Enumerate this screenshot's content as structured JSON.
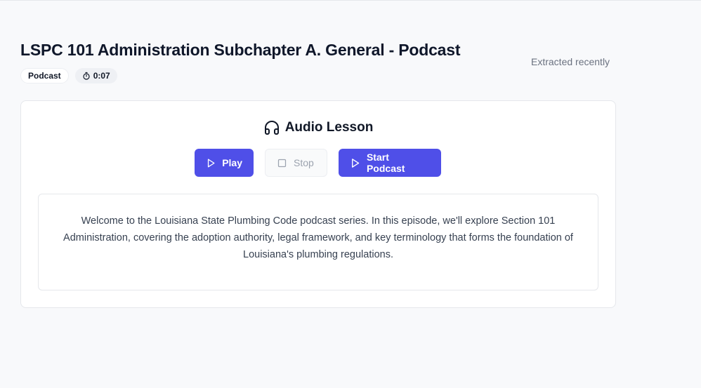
{
  "page": {
    "title": "LSPC 101 Administration Subchapter A. General - Podcast",
    "extracted_status": "Extracted recently",
    "badges": {
      "type": "Podcast",
      "duration": "0:07",
      "duration_icon": "stopwatch-icon"
    }
  },
  "audio_card": {
    "heading": "Audio Lesson",
    "heading_icon": "headphones-icon",
    "buttons": {
      "play": {
        "label": "Play",
        "icon": "play-icon"
      },
      "stop": {
        "label": "Stop",
        "icon": "stop-icon",
        "disabled": true
      },
      "start_podcast": {
        "label": "Start Podcast",
        "icon": "play-icon"
      }
    },
    "transcript": "Welcome to the Louisiana State Plumbing Code podcast series. In this episode, we'll explore Section 101 Administration, covering the adoption authority, legal framework, and key terminology that forms the foundation of Louisiana's plumbing regulations."
  },
  "colors": {
    "accent": "#4f4fe8",
    "background": "#f8f9fb",
    "muted_text": "#6b7280"
  }
}
